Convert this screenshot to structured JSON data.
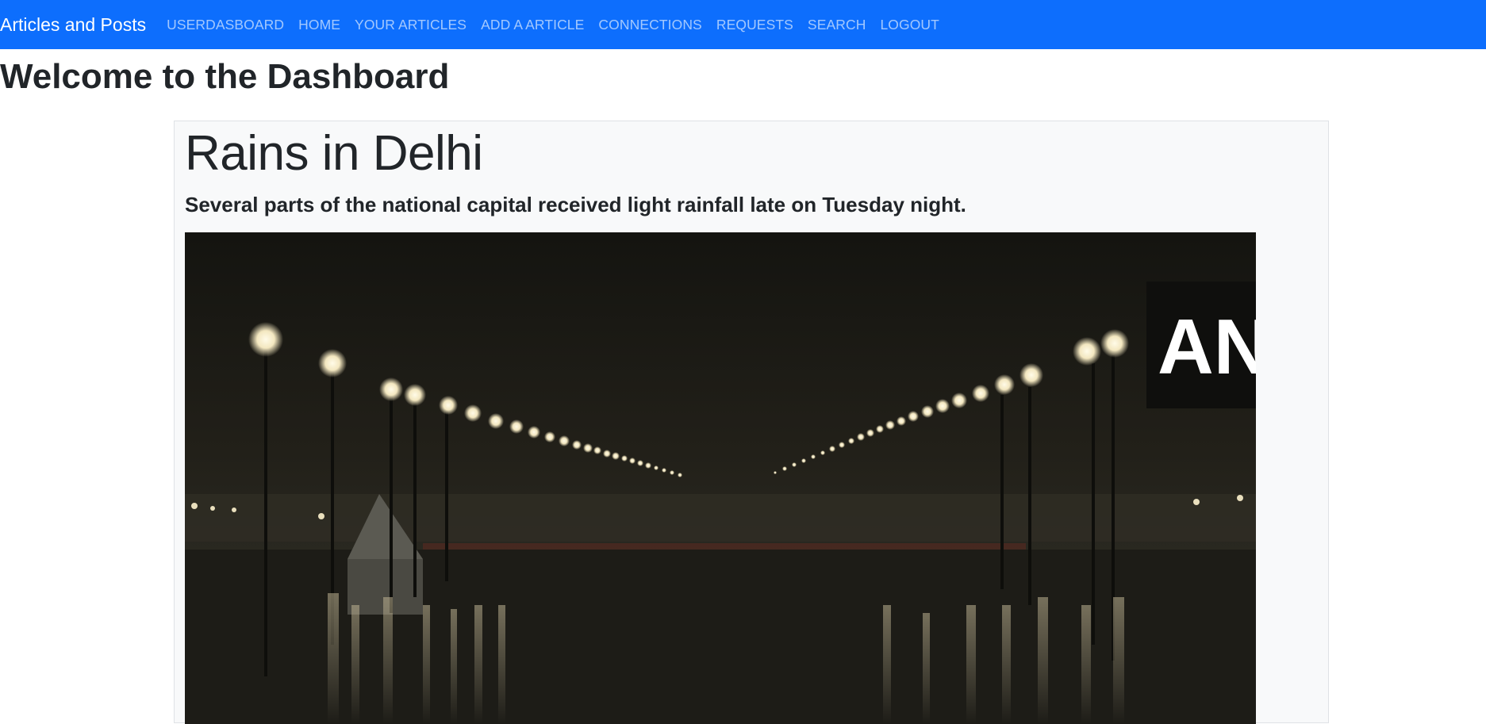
{
  "navbar": {
    "brand": "Articles and Posts",
    "links": [
      "USERDASBOARD",
      "HOME",
      "YOUR ARTICLES",
      "ADD A ARTICLE",
      "CONNECTIONS",
      "REQUESTS",
      "SEARCH",
      "LOGOUT"
    ]
  },
  "page": {
    "title": "Welcome to the Dashboard"
  },
  "article": {
    "title": "Rains in Delhi",
    "summary": "Several parts of the national capital received light rainfall late on Tuesday night.",
    "image_watermark": "ANI"
  },
  "colors": {
    "navbar": "#0d6efd",
    "card_bg": "#f8f9fa"
  }
}
